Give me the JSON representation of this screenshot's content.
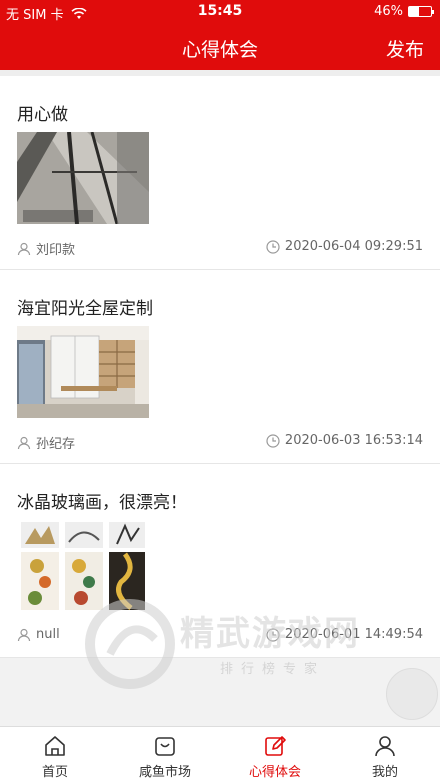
{
  "status_bar": {
    "carrier": "无 SIM 卡",
    "time": "15:45",
    "battery": "46%",
    "battery_level": 0.46
  },
  "header": {
    "title": "心得体会",
    "publish_label": "发布"
  },
  "posts": [
    {
      "title": "用心做",
      "author": "刘印款",
      "time": "2020-06-04 09:29:51"
    },
    {
      "title": "海宜阳光全屋定制",
      "author": "孙纪存",
      "time": "2020-06-03 16:53:14"
    },
    {
      "title": "冰晶玻璃画，很漂亮！",
      "author": "null",
      "time": "2020-06-01 14:49:54"
    }
  ],
  "tabs": [
    {
      "label": "首页",
      "icon": "home-icon"
    },
    {
      "label": "咸鱼市场",
      "icon": "bag-icon"
    },
    {
      "label": "心得体会",
      "icon": "edit-icon"
    },
    {
      "label": "我的",
      "icon": "user-icon"
    }
  ],
  "watermark": {
    "main": "精武游戏网",
    "sub": "排行榜专家"
  },
  "colors": {
    "brand": "#e00c0c",
    "active_tab": "#e00c0c"
  }
}
